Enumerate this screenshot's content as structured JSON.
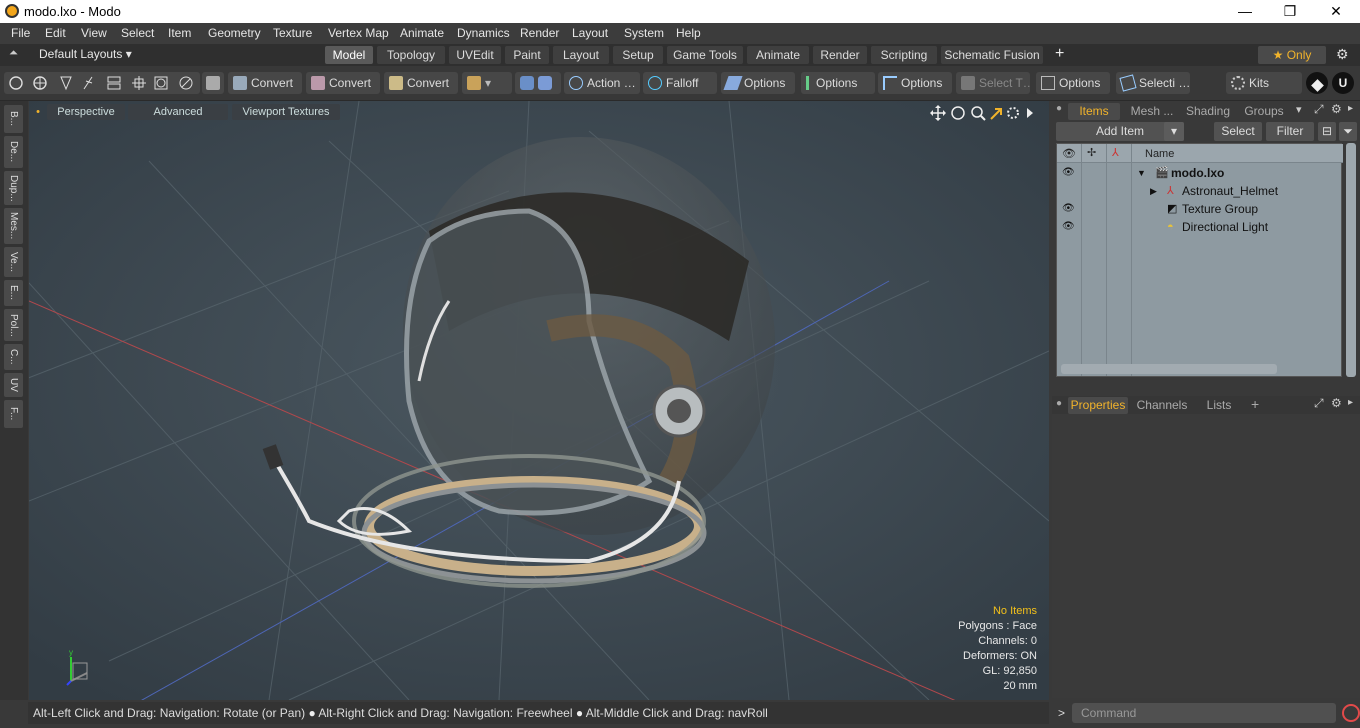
{
  "titlebar": {
    "title": "modo.lxo - Modo",
    "minimize": "—",
    "maximize": "❐",
    "close": "✕"
  },
  "menu": [
    "File",
    "Edit",
    "View",
    "Select",
    "Item",
    "Geometry",
    "Texture",
    "Vertex Map",
    "Animate",
    "Dynamics",
    "Render",
    "Layout",
    "System",
    "Help"
  ],
  "layouts": {
    "default_label": "Default Layouts ▾",
    "tabs": [
      "Model",
      "Topology",
      "UVEdit",
      "Paint",
      "Layout",
      "Setup",
      "Game Tools",
      "Animate",
      "Render",
      "Scripting",
      "Schematic Fusion"
    ],
    "active": "Model",
    "add": "+",
    "only_label": "★ Only",
    "gear": "⚙"
  },
  "toolbar": {
    "convert1": "Convert",
    "convert2": "Convert",
    "convert3": "Convert",
    "action": "Action",
    "action_more": "…",
    "falloff": "Falloff",
    "options1": "Options",
    "options2": "Options",
    "options3": "Options",
    "options4": "Options",
    "select_t": "Select T…",
    "selecti": "Selecti …",
    "kits": "Kits"
  },
  "left_tabs": [
    "B...",
    "De...",
    "Dup...",
    "Mes...",
    "Ve...",
    "E...",
    "Pol...",
    "C...",
    "UV",
    "F..."
  ],
  "viewport": {
    "tabs": [
      "Perspective",
      "Advanced",
      "Viewport Textures"
    ],
    "info": {
      "selection": "No Items",
      "polygons": "Polygons : Face",
      "channels": "Channels: 0",
      "deformers": "Deformers: ON",
      "gl": "GL: 92,850",
      "focal": "20 mm"
    }
  },
  "status": {
    "hint1": "Alt-Left Click and Drag: Navigation: Rotate (or Pan)",
    "hint2": "Alt-Right Click and Drag: Navigation: Freewheel",
    "hint3": "Alt-Middle Click and Drag: navRoll"
  },
  "items_panel": {
    "tabs": [
      "Items",
      "Mesh ...",
      "Shading",
      "Groups"
    ],
    "active": "Items",
    "add_item": "Add Item",
    "select": "Select",
    "filter": "Filter",
    "name_header": "Name",
    "rows": [
      {
        "name": "modo.lxo",
        "bold": true
      },
      {
        "name": "Astronaut_Helmet"
      },
      {
        "name": "Texture Group"
      },
      {
        "name": "Directional Light"
      }
    ]
  },
  "properties_panel": {
    "tabs": [
      "Properties",
      "Channels",
      "Lists"
    ],
    "active": "Properties",
    "add": "+"
  },
  "command": {
    "prompt": ">",
    "placeholder": "Command"
  }
}
